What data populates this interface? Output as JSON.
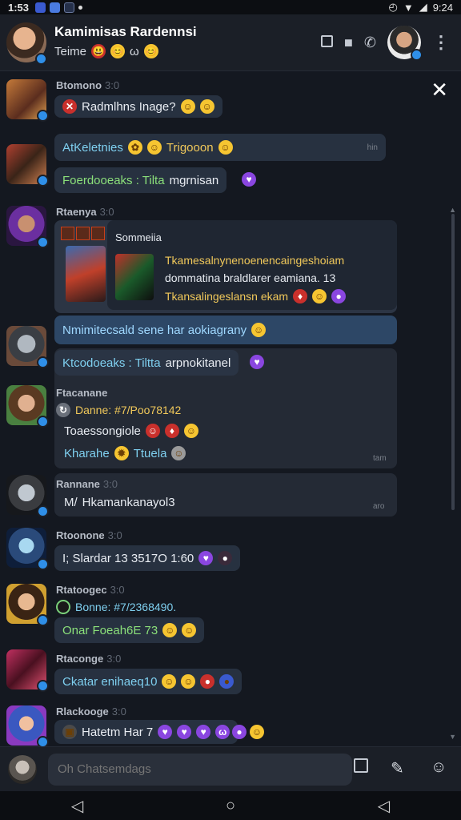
{
  "status": {
    "time": "1:53",
    "battery": "9:24"
  },
  "header": {
    "title": "Kamimisas Rardennsi",
    "subtitle": "Teime",
    "sub_emojis": [
      "😃",
      "😊",
      "ω",
      "😊"
    ]
  },
  "messages": [
    {
      "sender": "Btomono",
      "time": "3:0",
      "text": "Radmlhns Inage?"
    },
    {
      "sender": "",
      "bubbles": [
        {
          "text": "AtKeletnies",
          "extra": "Trigooon",
          "time": "hin"
        },
        {
          "text": "Foerdooeaks : Tilta",
          "extra": "mgrnisan"
        }
      ]
    },
    {
      "sender": "Rtaenya",
      "time": "3:0",
      "card": {
        "title": "Sommeiia",
        "l1": "Tkamesalnynenoenencaingeshoiam",
        "l2": "dommatina braldlarer eamiana. 13",
        "l3": "Tkansalingeslansn ekam"
      }
    },
    {
      "sender": "",
      "bubbles": [
        {
          "text": "Nmimitecsald sene har aokiagrany",
          "blue": true
        },
        {
          "text": "Ktcodoeaks : Tiltta",
          "extra": "arpnokitanel"
        }
      ]
    },
    {
      "sender": "Ftacanane",
      "rows": [
        {
          "text": "Danne: #7/Poo78142"
        },
        {
          "text": "Toaessongiole"
        },
        {
          "text": "Kharahe",
          "extra": "Ttuela",
          "time": "tam"
        }
      ]
    },
    {
      "sender": "Rannane",
      "time": "3:0",
      "rows": [
        {
          "text": "Hkamankanayol3",
          "time": "aro"
        }
      ]
    },
    {
      "sender": "Rtoonone",
      "time": "3:0",
      "bubbles": [
        {
          "text": "I; Slardar 13 3517O 1:60"
        }
      ]
    },
    {
      "sender": "Rtatoogec",
      "time": "3:0",
      "rows": [
        {
          "text": "Bonne: #7/2368490."
        },
        {
          "text": "Onar Foeah6E 73"
        }
      ]
    },
    {
      "sender": "Rtaconge",
      "time": "3:0",
      "bubbles": [
        {
          "text": "Ckatar enihaeq10"
        }
      ]
    },
    {
      "sender": "Rlackooge",
      "time": "3:0",
      "bubbles": [
        {
          "text": "Hatetm Har 7"
        }
      ]
    }
  ],
  "composer": {
    "placeholder": "Oh Chatsemdags"
  }
}
